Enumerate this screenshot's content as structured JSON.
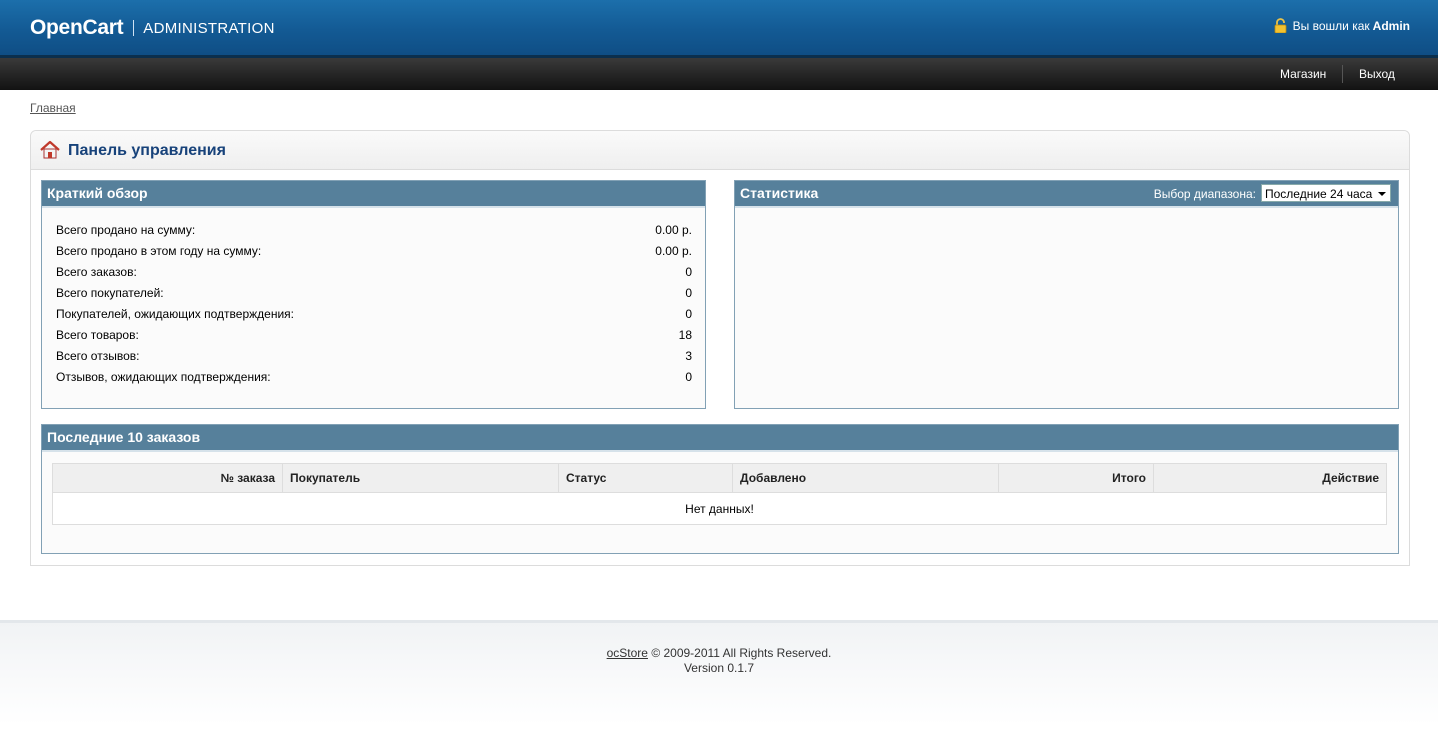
{
  "header": {
    "logo": "OpenCart",
    "subtitle": "ADMINISTRATION",
    "login_prefix": "Вы вошли как",
    "login_user": "Admin"
  },
  "nav": {
    "store": "Магазин",
    "logout": "Выход"
  },
  "breadcrumb": "Главная",
  "page_title": "Панель управления",
  "overview": {
    "title": "Краткий обзор",
    "rows": [
      {
        "label": "Всего продано на сумму:",
        "value": "0.00 р."
      },
      {
        "label": "Всего продано в этом году на сумму:",
        "value": "0.00 р."
      },
      {
        "label": "Всего заказов:",
        "value": "0"
      },
      {
        "label": "Всего покупателей:",
        "value": "0"
      },
      {
        "label": "Покупателей, ожидающих подтверждения:",
        "value": "0"
      },
      {
        "label": "Всего товаров:",
        "value": "18"
      },
      {
        "label": "Всего отзывов:",
        "value": "3"
      },
      {
        "label": "Отзывов, ожидающих подтверждения:",
        "value": "0"
      }
    ]
  },
  "stats": {
    "title": "Статистика",
    "range_label": "Выбор диапазона:",
    "range_value": "Последние 24 часа"
  },
  "orders": {
    "title": "Последние 10 заказов",
    "columns": [
      "№ заказа",
      "Покупатель",
      "Статус",
      "Добавлено",
      "Итого",
      "Действие"
    ],
    "empty": "Нет данных!"
  },
  "footer": {
    "brand": "ocStore",
    "copyright": "© 2009-2011 All Rights Reserved.",
    "version": "Version 0.1.7"
  },
  "colors": {
    "header_blue": "#135a94",
    "panel_head": "#56809b",
    "title_blue": "#17427a"
  }
}
